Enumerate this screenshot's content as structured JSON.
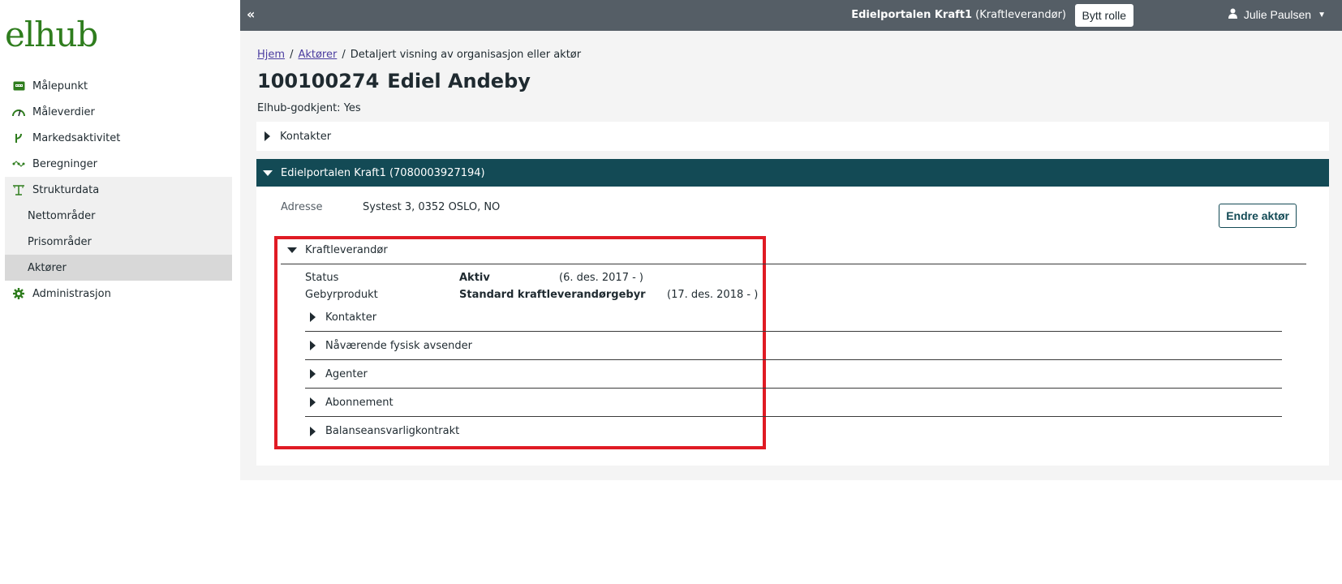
{
  "sidebar": {
    "logo": "elhub",
    "items": [
      {
        "label": "Målepunkt",
        "icon": "meter-icon",
        "color": "#2f7d1e"
      },
      {
        "label": "Måleverdier",
        "icon": "gauge-icon",
        "color": "#2f7d1e"
      },
      {
        "label": "Markedsaktivitet",
        "icon": "branch-icon",
        "color": "#2f7d1e"
      },
      {
        "label": "Beregninger",
        "icon": "calc-icon",
        "color": "#2f7d1e"
      },
      {
        "label": "Strukturdata",
        "icon": "pylon-icon",
        "color": "#2f7d1e"
      },
      {
        "label": "Nettområder"
      },
      {
        "label": "Prisområder"
      },
      {
        "label": "Aktører"
      },
      {
        "label": "Administrasjon",
        "icon": "gear-icon",
        "color": "#2f7d1e"
      }
    ]
  },
  "topbar": {
    "collapse": "«",
    "portal_name": "Edielportalen Kraft1",
    "portal_role": "(Kraftleverandør)",
    "switch_role": "Bytt rolle",
    "user_name": "Julie Paulsen"
  },
  "breadcrumb": {
    "home": "Hjem",
    "actors": "Aktører",
    "current": "Detaljert visning av organisasjon eller aktør",
    "sep": "/"
  },
  "page": {
    "id": "100100274",
    "name": "Ediel Andeby",
    "approved": "Elhub-godkjent: Yes"
  },
  "contacts_section": {
    "label": "Kontakter"
  },
  "actor_section": {
    "label": "Edielportalen Kraft1 (7080003927194)",
    "color": "#134a55",
    "address_label": "Adresse",
    "address_value": "Systest 3, 0352 OSLO, NO",
    "edit_button": "Endre aktør"
  },
  "role_section": {
    "label": "Kraftleverandør",
    "highlight_color": "#e01b24",
    "status_label": "Status",
    "status_value": "Aktiv",
    "status_date": "(6. des. 2017 - )",
    "fee_label": "Gebyrprodukt",
    "fee_value": "Standard kraftleverandørgebyr",
    "fee_date": "(17. des. 2018 - )",
    "children": [
      "Kontakter",
      "Nåværende fysisk avsender",
      "Agenter",
      "Abonnement",
      "Balanseansvarligkontrakt"
    ]
  }
}
